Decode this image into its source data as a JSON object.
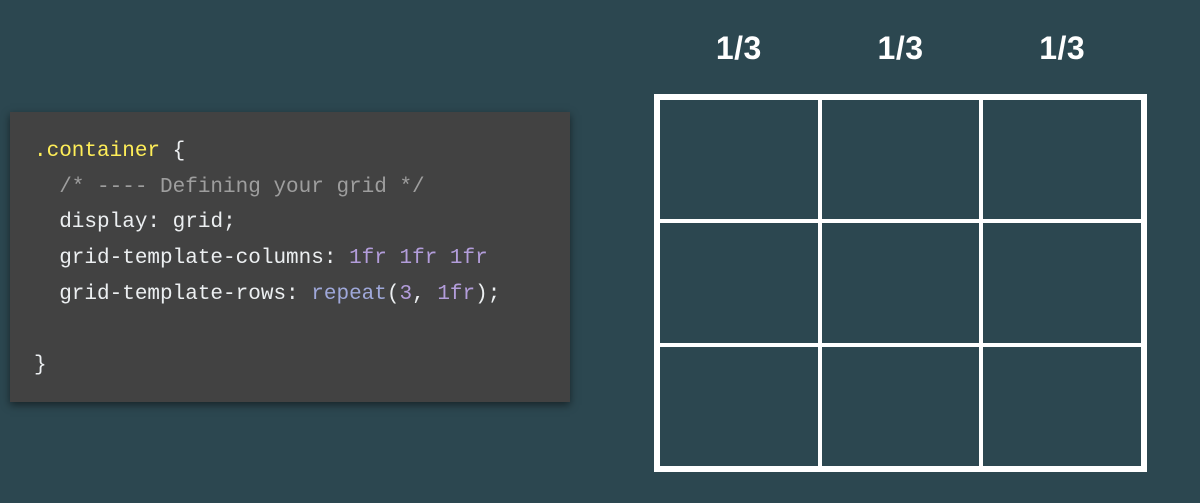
{
  "code": {
    "selector_line_open": ".container {",
    "comment": "  /* ---- Defining your grid */",
    "prop_display_key": "  display",
    "prop_display_val": "grid",
    "prop_cols_key": "  grid-template-columns",
    "prop_cols_val_fr": "1fr 1fr 1fr",
    "prop_rows_key": "  grid-template-rows",
    "prop_rows_fn": "repeat",
    "prop_rows_arg1": "3",
    "prop_rows_arg2": "1fr",
    "close_brace": "}"
  },
  "grid": {
    "columns": 3,
    "rows": 3
  },
  "column_labels": [
    "1/3",
    "1/3",
    "1/3"
  ]
}
